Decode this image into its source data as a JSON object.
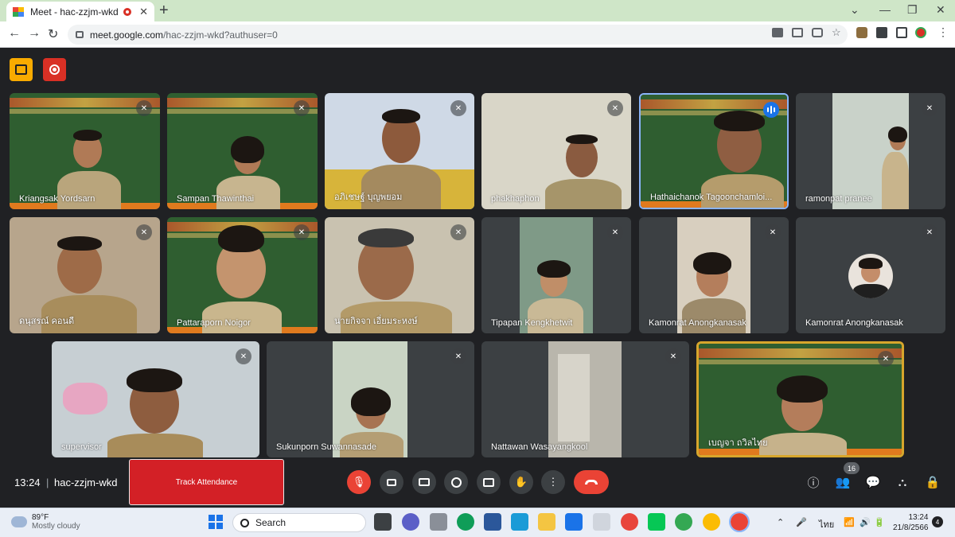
{
  "browser": {
    "tab_title": "Meet - hac-zzjm-wkd",
    "tab_close": "✕",
    "new_tab": "+",
    "url_host": "meet.google.com",
    "url_path": "/hac-zzjm-wkd?authuser=0",
    "window_controls": [
      "⌄",
      "—",
      "❐",
      "✕"
    ]
  },
  "participants": [
    {
      "name": "Kriangsak Yordsarn"
    },
    {
      "name": "Sampan Thawinthai"
    },
    {
      "name": "อภิเชษฐ์ บุญพยอม"
    },
    {
      "name": "phakhaphon"
    },
    {
      "name": "Hathaichanok Tagoonchamloi..."
    },
    {
      "name": "ramonpat pranee"
    },
    {
      "name": "ดนุสรณ์ คอนดี"
    },
    {
      "name": "Pattaraporn Noigor"
    },
    {
      "name": "นายกิจจา เอี่ยมระหงษ์"
    },
    {
      "name": "Tipapan Kengkhetwit"
    },
    {
      "name": "Kamonrat Anongkanasak"
    },
    {
      "name": "Kamonrat Anongkanasak"
    },
    {
      "name": "supervisor"
    },
    {
      "name": "Sukunporn Suwannasade"
    },
    {
      "name": "Nattawan Wasayangkool"
    },
    {
      "name": "เบญจา ถวิลไทย"
    }
  ],
  "controls": {
    "time": "13:24",
    "separator": "|",
    "meeting_code": "hac-zzjm-wkd",
    "track_attendance": "Track Attendance",
    "participant_count": "16",
    "icons": [
      "mic-off-icon",
      "camera-icon",
      "captions-icon",
      "emoji-icon",
      "present-icon",
      "raise-hand-icon",
      "more-icon",
      "hangup-icon",
      "info-icon",
      "people-icon",
      "chat-icon",
      "activities-icon",
      "host-controls-icon"
    ]
  },
  "taskbar": {
    "temperature": "89°F",
    "condition": "Mostly cloudy",
    "search_placeholder": "Search",
    "language": "ไทย",
    "clock_time": "13:24",
    "clock_date": "21/8/2566",
    "notification_count": "4"
  },
  "colors": {
    "meet_bg": "#202124",
    "tile_bg": "#3c4043",
    "attendance_red": "#d32026",
    "active_speaker": "#8ab4f8",
    "hangup_red": "#ea4335",
    "tab_strip": "#cfe6c8"
  }
}
